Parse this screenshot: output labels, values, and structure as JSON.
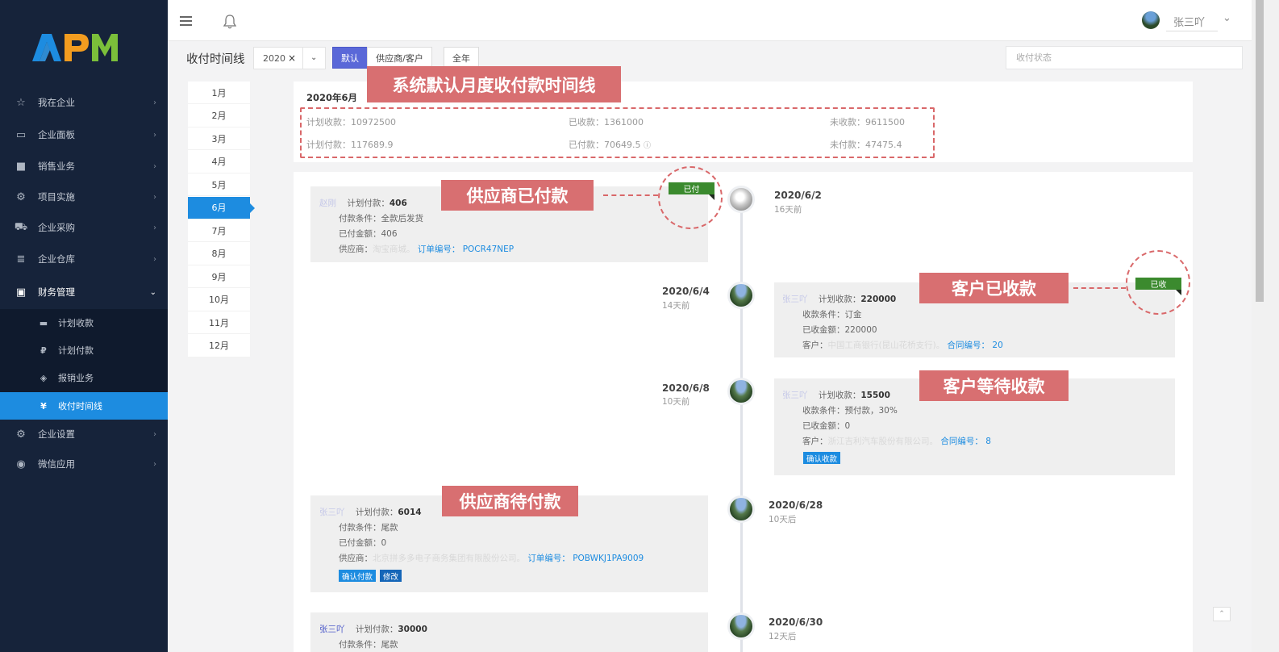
{
  "app": {
    "logo_text": "APM"
  },
  "sidebar": {
    "items": [
      {
        "icon": "star-icon",
        "glyph": "☆",
        "label": "我在企业"
      },
      {
        "icon": "monitor-icon",
        "glyph": "▭",
        "label": "企业面板"
      },
      {
        "icon": "briefcase-icon",
        "glyph": "■",
        "label": "销售业务"
      },
      {
        "icon": "cogs-icon",
        "glyph": "⚙",
        "label": "项目实施"
      },
      {
        "icon": "cart-icon",
        "glyph": "⛟",
        "label": "企业采购"
      },
      {
        "icon": "database-icon",
        "glyph": "≣",
        "label": "企业仓库"
      },
      {
        "icon": "monitor-icon",
        "glyph": "▣",
        "label": "财务管理"
      }
    ],
    "finance_sub": [
      {
        "icon": "visa-icon",
        "glyph": "▬",
        "label": "计划收款"
      },
      {
        "icon": "ruble-icon",
        "glyph": "₽",
        "label": "计划付款"
      },
      {
        "icon": "tag-icon",
        "glyph": "◈",
        "label": "报销业务"
      },
      {
        "icon": "yen-icon",
        "glyph": "¥",
        "label": "收付时间线"
      }
    ],
    "bottom_items": [
      {
        "icon": "gear-icon",
        "glyph": "⚙",
        "label": "企业设置"
      },
      {
        "icon": "wechat-icon",
        "glyph": "◉",
        "label": "微信应用"
      }
    ]
  },
  "topbar": {
    "user_name": "张三吖"
  },
  "filter": {
    "page_title": "收付时间线",
    "year": "2020",
    "clear_glyph": "×",
    "tab_default": "默认",
    "tab_supplier": "供应商/客户",
    "btn_full_year": "全年",
    "status_placeholder": "收付状态"
  },
  "months": [
    "1月",
    "2月",
    "3月",
    "4月",
    "5月",
    "6月",
    "7月",
    "8月",
    "9月",
    "10月",
    "11月",
    "12月"
  ],
  "summary": {
    "title": "2020年6月",
    "plan_receive_label": "计划收款：",
    "plan_receive": "10972500",
    "received_label": "已收款：",
    "received": "1361000",
    "unreceived_label": "未收款：",
    "unreceived": "9611500",
    "plan_pay_label": "计划付款：",
    "plan_pay": "117689.9",
    "paid_label": "已付款：",
    "paid": "70649.5",
    "unpaid_label": "未付款：",
    "unpaid": "47475.4"
  },
  "timeline": [
    {
      "date": "2020/6/2",
      "ago": "16天前",
      "name": "赵刚",
      "amount_label": "计划付款：",
      "amount": "406",
      "cond_label": "付款条件：",
      "cond": "全款后发货",
      "done_label": "已付金额：",
      "done": "406",
      "party_label": "供应商：",
      "party": "淘宝商城。",
      "order_label": "订单编号：",
      "order": "POCR47NEP",
      "ribbon": "已付"
    },
    {
      "date": "2020/6/4",
      "ago": "14天前",
      "name": "张三吖",
      "amount_label": "计划收款：",
      "amount": "220000",
      "cond_label": "收款条件：",
      "cond": "订金",
      "done_label": "已收金额：",
      "done": "220000",
      "party_label": "客户：",
      "party": "中国工商银行(昆山花桥支行)。",
      "order_label": "合同编号：",
      "order": "20",
      "ribbon": "已收"
    },
    {
      "date": "2020/6/8",
      "ago": "10天前",
      "name": "张三吖",
      "amount_label": "计划收款：",
      "amount": "15500",
      "cond_label": "收款条件：",
      "cond": "预付款，30%",
      "done_label": "已收金额：",
      "done": "0",
      "party_label": "客户：",
      "party": "浙江吉利汽车股份有限公司。",
      "order_label": "合同编号：",
      "order": "8",
      "btn_confirm": "确认收款"
    },
    {
      "date": "2020/6/28",
      "ago": "10天后",
      "name": "张三吖",
      "amount_label": "计划付款：",
      "amount": "6014",
      "cond_label": "付款条件：",
      "cond": "尾款",
      "done_label": "已付金额：",
      "done": "0",
      "party_label": "供应商：",
      "party": "北京拼多多电子商务集团有限股份公司。",
      "order_label": "订单编号：",
      "order": "POBWKJ1PA9009",
      "btn_confirm": "确认付款",
      "btn_edit": "修改"
    },
    {
      "date": "2020/6/30",
      "ago": "12天后",
      "name": "张三吖",
      "amount_label": "计划付款：",
      "amount": "30000",
      "cond_label": "付款条件：",
      "cond": "尾款"
    }
  ],
  "annotations": {
    "summary_note": "系统默认月度收付款时间线",
    "supplier_paid": "供应商已付款",
    "customer_received": "客户已收款",
    "customer_waiting": "客户等待收款",
    "supplier_waiting": "供应商待付款"
  },
  "colors": {
    "sidebar_bg": "#16233a",
    "accent": "#1d8ce0",
    "default_tab": "#5a68d8",
    "ribbon": "#3b8a2e",
    "annotation": "#d86f71"
  }
}
